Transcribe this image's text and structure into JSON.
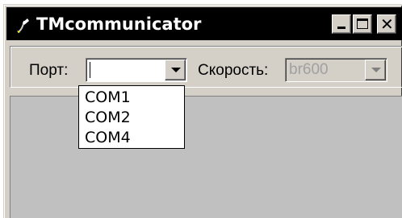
{
  "window": {
    "title": "TMcommunicator",
    "icon": "app-icon",
    "controls": {
      "minimize_icon": "minimize-icon",
      "maximize_icon": "maximize-icon",
      "close_glyph": "✕"
    }
  },
  "toolbar": {
    "port_label": "Порт:",
    "port_value": "",
    "speed_label": "Скорость:",
    "speed_value": "br600"
  },
  "port_dropdown": {
    "options": [
      "COM1",
      "COM2",
      "COM4"
    ]
  },
  "colors": {
    "face": "#d4d0c8",
    "title_bar": "#000000",
    "client": "#c0c0c0",
    "disabled_text": "#a0a0a0"
  }
}
